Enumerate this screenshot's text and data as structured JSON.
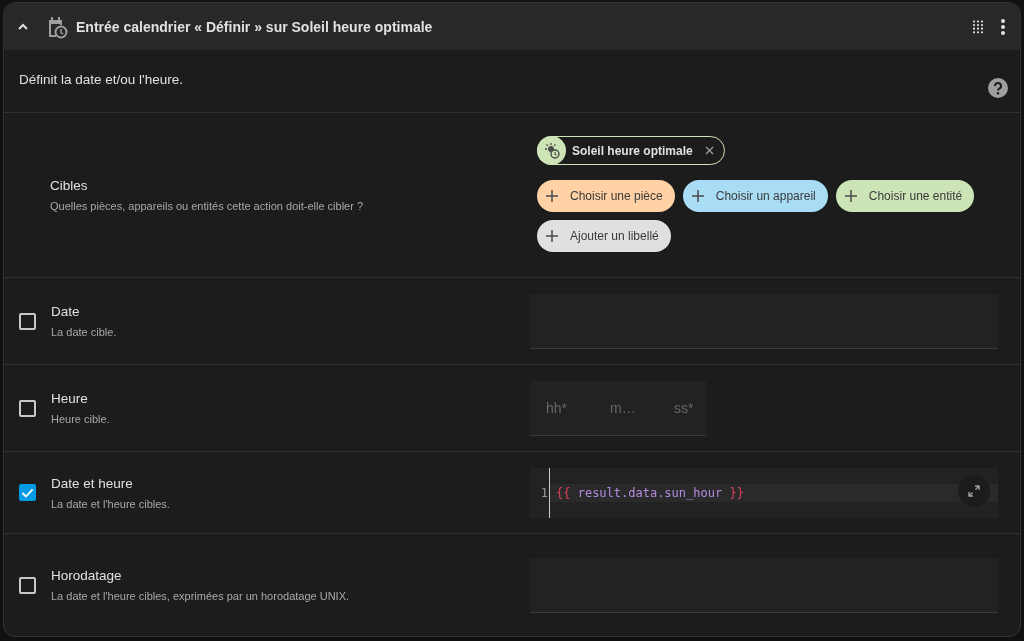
{
  "header": {
    "title": "Entrée calendrier « Définir » sur Soleil heure optimale",
    "expanded": true
  },
  "description": "Définit la date et/ou l'heure.",
  "targets": {
    "label": "Cibles",
    "description": "Quelles pièces, appareils ou entités cette action doit-elle cibler ?",
    "chips": [
      {
        "label": "Soleil heure optimale"
      }
    ],
    "buttons": [
      {
        "label": "Choisir une pièce",
        "color": "#ffd1a4"
      },
      {
        "label": "Choisir un appareil",
        "color": "#a9ddf6"
      },
      {
        "label": "Choisir une entité",
        "color": "#cde4b6"
      },
      {
        "label": "Ajouter un libellé",
        "color": "#e0e0e0"
      }
    ]
  },
  "fields": [
    {
      "kind": "date",
      "label": "Date",
      "description": "La date cible.",
      "checked": false
    },
    {
      "kind": "time",
      "label": "Heure",
      "description": "Heure cible.",
      "checked": false,
      "placeholders": [
        "hh*",
        "m…",
        "ss*"
      ]
    },
    {
      "kind": "template",
      "label": "Date et heure",
      "description": "La date et l'heure cibles.",
      "checked": true,
      "line_number": "1",
      "tokens": [
        {
          "kind": "brace",
          "text": "{{"
        },
        {
          "kind": "expr",
          "text": " result.data.sun_hour "
        },
        {
          "kind": "brace",
          "text": "}}"
        }
      ]
    },
    {
      "kind": "timestamp",
      "label": "Horodatage",
      "description": "La date et l'heure cibles, exprimées par un horodatage UNIX.",
      "checked": false
    }
  ]
}
